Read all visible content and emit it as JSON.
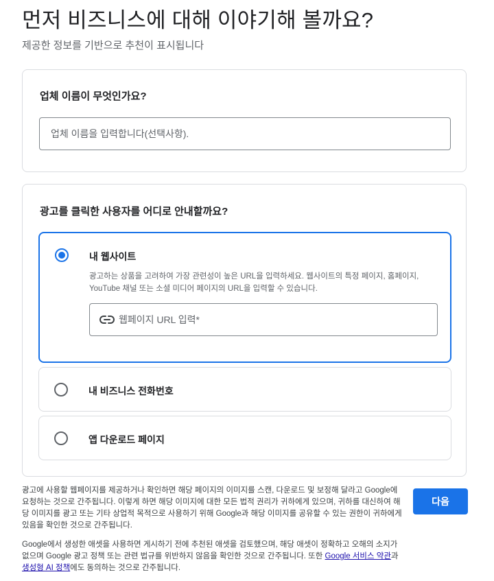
{
  "header": {
    "title": "먼저 비즈니스에 대해 이야기해 볼까요?",
    "subtitle": "제공한 정보를 기반으로 추천이 표시됩니다"
  },
  "business_name": {
    "question": "업체 이름이 무엇인가요?",
    "placeholder": "업체 이름을 입력합니다(선택사항).",
    "value": ""
  },
  "destination": {
    "question": "광고를 클릭한 사용자를 어디로 안내할까요?",
    "options": [
      {
        "label": "내 웹사이트",
        "selected": true,
        "description": "광고하는 상품을 고려하여 가장 관련성이 높은 URL을 입력하세요. 웹사이트의 특정 페이지, 홈페이지, YouTube 채널 또는 소셜 미디어 페이지의 URL을 입력할 수 있습니다.",
        "url_placeholder": "웹페이지 URL 입력*",
        "url_value": "",
        "url_icon": "link-icon"
      },
      {
        "label": "내 비즈니스 전화번호",
        "selected": false
      },
      {
        "label": "앱 다운로드 페이지",
        "selected": false
      }
    ]
  },
  "footer": {
    "paragraph1": "광고에 사용할 웹페이지를 제공하거나 확인하면 해당 페이지의 이미지를 스캔, 다운로드 및 보정해 달라고 Google에 요청하는 것으로 간주됩니다. 이렇게 하면 해당 이미지에 대한 모든 법적 권리가 귀하에게 있으며, 귀하를 대신하여 해당 이미지를 광고 또는 기타 상업적 목적으로 사용하기 위해 Google과 해당 이미지를 공유할 수 있는 권한이 귀하에게 있음을 확인한 것으로 간주됩니다.",
    "paragraph2_before": "Google에서 생성한 애셋을 사용하면 게시하기 전에 추천된 애셋을 검토했으며, 해당 애셋이 정확하고 오해의 소지가 없으며 Google 광고 정책 또는 관련 법규를 위반하지 않음을 확인한 것으로 간주됩니다. 또한 ",
    "link_terms": "Google 서비스 약관",
    "paragraph2_middle": "과 ",
    "link_ai_policy": "생성형 AI 정책",
    "paragraph2_after": "에도 동의하는 것으로 간주됩니다."
  },
  "next_button": "다음",
  "colors": {
    "accent": "#1a73e8",
    "border": "#dadce0",
    "text_primary": "#202124",
    "text_secondary": "#5f6368",
    "link": "#1a0dab"
  }
}
